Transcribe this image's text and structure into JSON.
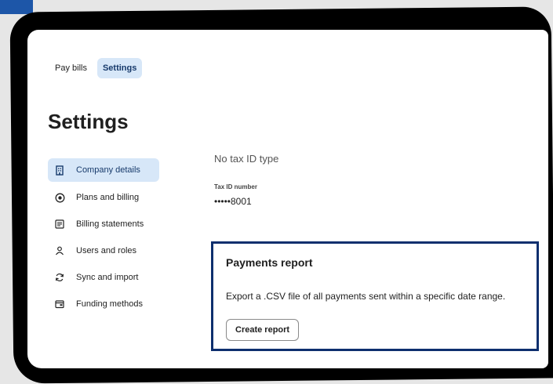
{
  "nav": {
    "items": [
      {
        "label": "Pay bills"
      },
      {
        "label": "Settings"
      }
    ]
  },
  "page": {
    "title": "Settings"
  },
  "sidebar": {
    "items": [
      {
        "label": "Company details",
        "icon": "building-icon"
      },
      {
        "label": "Plans and billing",
        "icon": "plan-icon"
      },
      {
        "label": "Billing statements",
        "icon": "statement-icon"
      },
      {
        "label": "Users and roles",
        "icon": "user-icon"
      },
      {
        "label": "Sync and import",
        "icon": "sync-icon"
      },
      {
        "label": "Funding methods",
        "icon": "wallet-icon"
      }
    ]
  },
  "company": {
    "tax_id_type": "No tax ID type",
    "tax_id_label": "Tax ID number",
    "tax_id_value": "•••••8001"
  },
  "payments_report": {
    "title": "Payments report",
    "description": "Export a .CSV file of all payments sent within a specific date range.",
    "button_label": "Create report"
  },
  "colors": {
    "accent": "#d7e7f8",
    "highlight_border": "#0e2f6e",
    "frame": "#000000"
  }
}
